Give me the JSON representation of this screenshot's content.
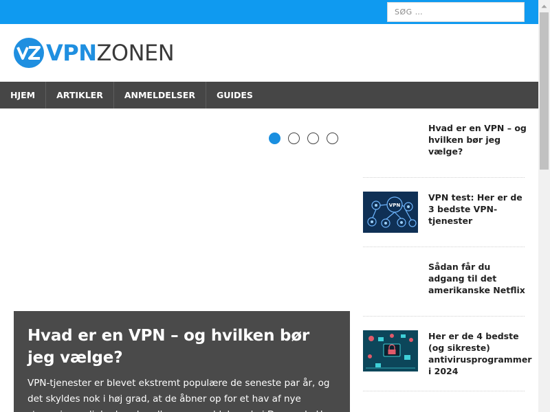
{
  "search": {
    "placeholder": "SØG …"
  },
  "logo": {
    "part1": "VPN",
    "part2": "ZONEN",
    "mark": "VZ"
  },
  "nav": {
    "items": [
      "HJEM",
      "ARTIKLER",
      "ANMELDELSER",
      "GUIDES"
    ]
  },
  "slider": {
    "slide_count": 4,
    "active_index": 0,
    "title": "Hvad er en VPN – og hvilken bør jeg vælge?",
    "excerpt": "VPN-tjenester er blevet ekstremt populære de seneste par år, og det skyldes nok i høj grad, at de åbner op for et hav af nye streamingmuligheder, der ellers er geo-blokerede i Danmark. Her"
  },
  "sidebar": {
    "posts": [
      {
        "title": "Hvad er en VPN – og hvilken bør jeg vælge?",
        "thumb": "none"
      },
      {
        "title": "VPN test: Her er de 3 bedste VPN-tjenester",
        "thumb": "vpn-network-image"
      },
      {
        "title": "Sådan får du adgang til det amerikanske Netflix",
        "thumb": "none"
      },
      {
        "title": "Her er de 4 bedste (og sikreste) antivirusprogrammer i 2024",
        "thumb": "cybersecurity-image"
      }
    ]
  },
  "colors": {
    "topbar": "#0f9af0",
    "nav": "#464646",
    "accent": "#1a8fe0",
    "featured_bg": "#4a4a4a"
  }
}
